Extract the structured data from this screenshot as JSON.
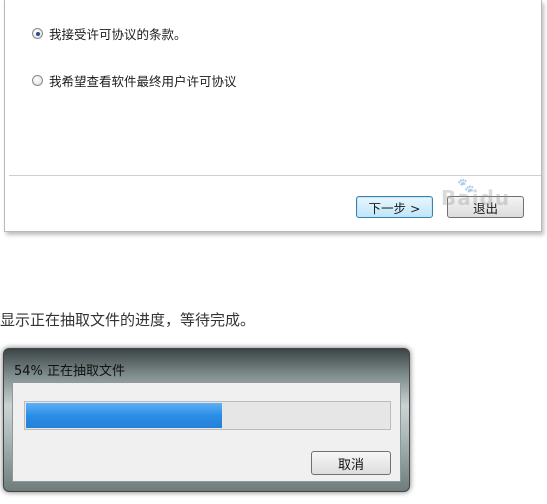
{
  "license_dialog": {
    "option_accept": {
      "label": "我接受许可协议的条款。",
      "checked": true
    },
    "option_view": {
      "label": "我希望查看软件最终用户许可协议",
      "checked": false
    },
    "next_button": "下一步 >",
    "quit_button": "退出",
    "watermark": "Baidu"
  },
  "caption": "显示正在抽取文件的进度，等待完成。",
  "progress_window": {
    "title": "54% 正在抽取文件",
    "progress_fraction": 0.54,
    "cancel_button": "取消"
  }
}
